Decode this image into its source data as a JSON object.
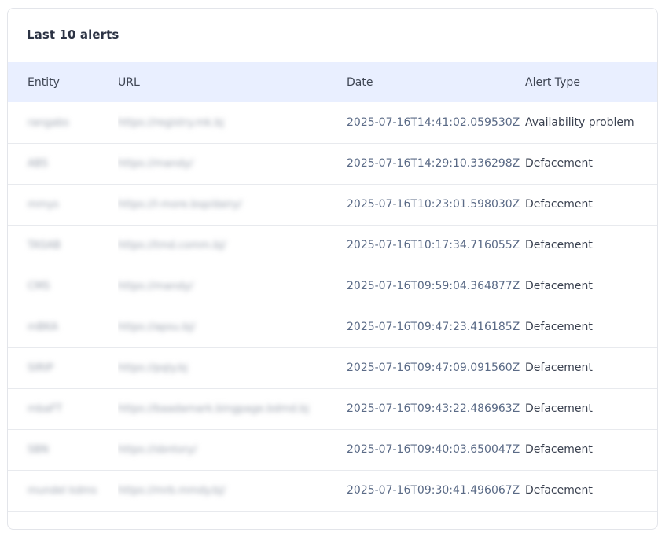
{
  "card": {
    "title": "Last 10 alerts"
  },
  "table": {
    "headers": {
      "entity": "Entity",
      "url": "URL",
      "date": "Date",
      "alert_type": "Alert Type"
    },
    "rows": [
      {
        "entity": "rangabs",
        "url": "https://registry.mk.bj",
        "date": "2025-07-16T14:41:02.059530Z",
        "alert_type": "Availability problem"
      },
      {
        "entity": "ABS",
        "url": "https://mandy/",
        "date": "2025-07-16T14:29:10.336298Z",
        "alert_type": "Defacement"
      },
      {
        "entity": "mmys",
        "url": "https://l-more.bsp/dairy/",
        "date": "2025-07-16T10:23:01.598030Z",
        "alert_type": "Defacement"
      },
      {
        "entity": "TASAB",
        "url": "https://tmd.comm.bj/",
        "date": "2025-07-16T10:17:34.716055Z",
        "alert_type": "Defacement"
      },
      {
        "entity": "CMS",
        "url": "https://mandy/",
        "date": "2025-07-16T09:59:04.364877Z",
        "alert_type": "Defacement"
      },
      {
        "entity": "mBKA",
        "url": "https://apsu.bj/",
        "date": "2025-07-16T09:47:23.416185Z",
        "alert_type": "Defacement"
      },
      {
        "entity": "SIRIP",
        "url": "https://pqly.bj",
        "date": "2025-07-16T09:47:09.091560Z",
        "alert_type": "Defacement"
      },
      {
        "entity": "mbaFT",
        "url": "https://baadamark.bingpage.bdmd.bj",
        "date": "2025-07-16T09:43:22.486963Z",
        "alert_type": "Defacement"
      },
      {
        "entity": "SBN",
        "url": "https://sbntory/",
        "date": "2025-07-16T09:40:03.650047Z",
        "alert_type": "Defacement"
      },
      {
        "entity": "mundel kdms",
        "url": "https://mrb.mmdy.bj/",
        "date": "2025-07-16T09:30:41.496067Z",
        "alert_type": "Defacement"
      }
    ]
  }
}
